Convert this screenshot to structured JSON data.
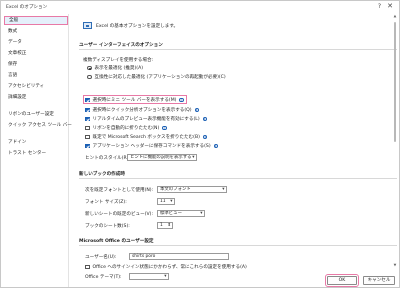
{
  "window": {
    "title": "Excel のオプション",
    "help": "?",
    "close": "✕"
  },
  "sidebar": {
    "items": [
      {
        "label": "全般"
      },
      {
        "label": "数式"
      },
      {
        "label": "データ"
      },
      {
        "label": "文章校正"
      },
      {
        "label": "保存"
      },
      {
        "label": "言語"
      },
      {
        "label": "アクセシビリティ"
      },
      {
        "label": "詳細設定"
      },
      {
        "label": "リボンのユーザー設定"
      },
      {
        "label": "クイック アクセス ツール バー"
      },
      {
        "label": "アドイン"
      },
      {
        "label": "トラスト センター"
      }
    ]
  },
  "intro": {
    "text": "Excel の基本オプションを設定します。"
  },
  "ui_section": {
    "heading": "ユーザー インターフェイスのオプション",
    "multi_display_label": "複数ディスプレイを使用する場合:",
    "radio_appearance": "表示を最適化 (推奨)(A)",
    "radio_compat": "互換性に対応した最適化 (アプリケーションの再起動が必要)(C)",
    "mini_toolbar": "選択時にミニ ツール バーを表示する(M)",
    "quick_analysis": "選択時にクイック分析オプションを表示する(Q)",
    "live_preview": "リアルタイムのプレビュー表示機能を有効にする(L)",
    "collapse_ribbon": "リボンを自動的に折りたたむ(N)",
    "search_box": "既定で Microsoft Search ボックスを折りたたむ(B)",
    "app_header": "アプリケーション ヘッダーに保存コマンドを表示する(S)",
    "screentip_label": "ヒントのスタイル(R):",
    "screentip_value": "ヒントに機能の説明を表示する"
  },
  "new_workbook": {
    "heading": "新しいブックの作成時",
    "default_font_label": "次を既定フォントとして使用(N):",
    "default_font_value": "本文のフォント",
    "font_size_label": "フォント サイズ(Z):",
    "font_size_value": "11",
    "view_label": "新しいシートの既定のビュー(V):",
    "view_value": "標準ビュー",
    "sheets_label": "ブックのシート数(S):",
    "sheets_value": "1"
  },
  "personalize": {
    "heading": "Microsoft Office のユーザー設定",
    "username_label": "ユーザー名(U):",
    "username_value": "shirts poro",
    "always_use": "Office へのサインイン状態にかかわらず、常にこれらの設定を使用する(A)",
    "theme_label": "Office テーマ(T):",
    "theme_value": ""
  },
  "footer": {
    "ok": "OK",
    "cancel": "キャンセル"
  },
  "colors": {
    "highlight": "#e879a6",
    "accent": "#1a5fb4"
  }
}
